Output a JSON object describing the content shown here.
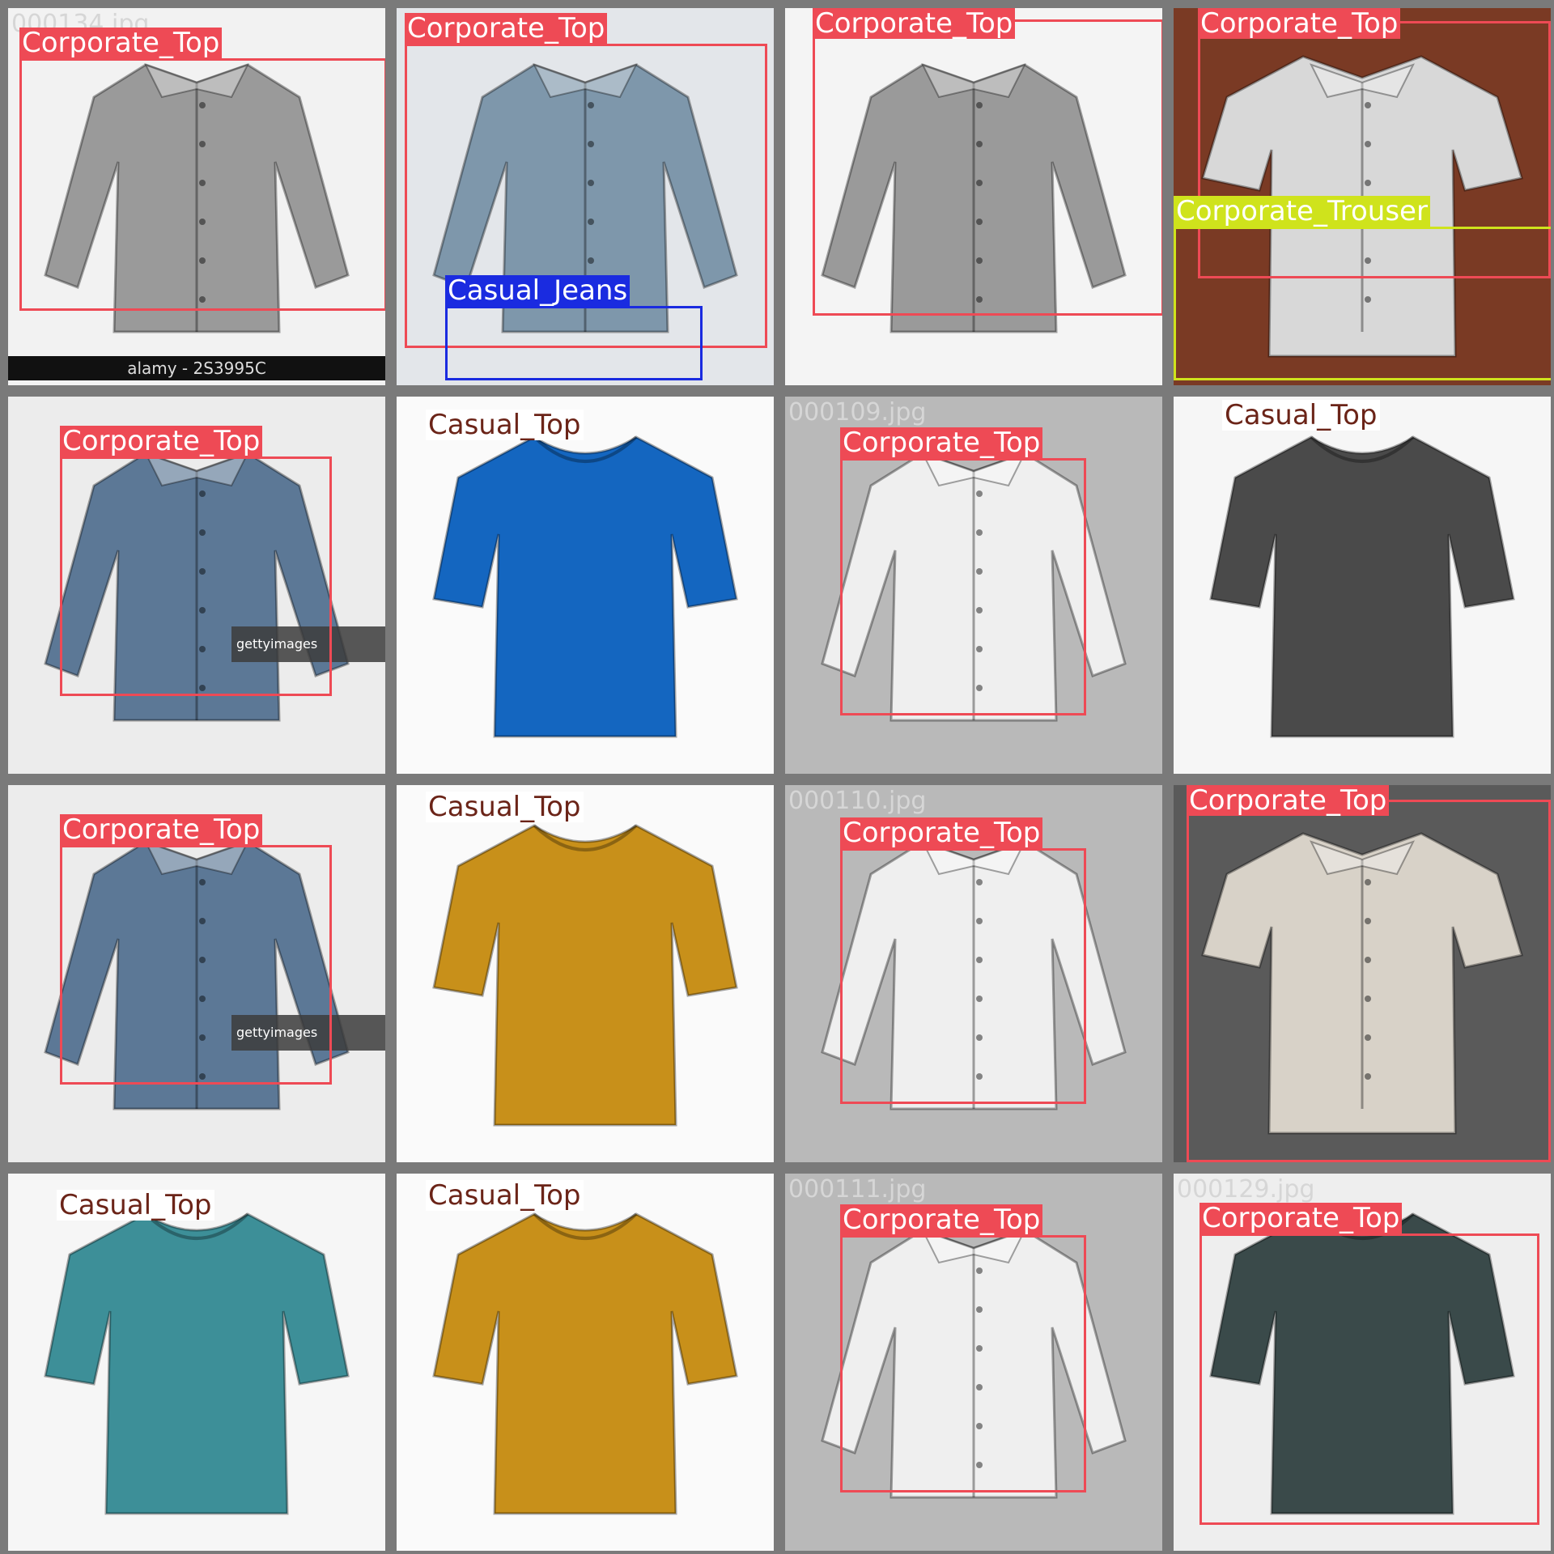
{
  "classes": {
    "Corporate_Top": {
      "box": "#ee4a55",
      "label_bg": "#ee4a55",
      "label_fg": "#ffffff"
    },
    "Casual_Jeans": {
      "box": "#1a2be0",
      "label_bg": "#1a2be0",
      "label_fg": "#ffffff"
    },
    "Corporate_Trouser": {
      "box": "#cfe31c",
      "label_bg": "#cfe31c",
      "label_fg": "#ffffff"
    },
    "Casual_Top": {
      "box": "#ffffff",
      "label_bg": "#ffffff",
      "label_fg": "#6b2418"
    }
  },
  "tiles": [
    {
      "filename": "000134.jpg",
      "bg": "#f2f2f2",
      "garment": "shirt-long",
      "color": "#9a9a9a",
      "watermark": "alamy - 2S3995C",
      "detections": [
        {
          "label": "Corporate_Top"
        }
      ]
    },
    {
      "filename": "",
      "bg": "#e3e6ea",
      "garment": "shirt-long",
      "color": "#7e97ab",
      "detections": [
        {
          "label": "Corporate_Top"
        },
        {
          "label": "Casual_Jeans"
        }
      ]
    },
    {
      "filename": "",
      "bg": "#f4f4f4",
      "garment": "shirt-long",
      "color": "#9a9a9a",
      "detections": [
        {
          "label": "Corporate_Top"
        }
      ]
    },
    {
      "filename": "",
      "bg": "#7a3a24",
      "garment": "shirt-short",
      "color": "#d8d8d8",
      "detections": [
        {
          "label": "Corporate_Top"
        },
        {
          "label": "Corporate_Trouser"
        }
      ]
    },
    {
      "filename": "",
      "bg": "#ececec",
      "garment": "shirt-long",
      "color": "#5c7896",
      "watermark": "gettyimages",
      "detections": [
        {
          "label": "Corporate_Top"
        }
      ]
    },
    {
      "filename": "",
      "bg": "#fafafa",
      "garment": "tee",
      "color": "#1466c0",
      "detections": [
        {
          "label": "Casual_Top"
        }
      ]
    },
    {
      "filename": "000109.jpg",
      "bg": "#b9b9b9",
      "garment": "shirt-long",
      "color": "#efefef",
      "detections": [
        {
          "label": "Corporate_Top"
        }
      ]
    },
    {
      "filename": "",
      "bg": "#f6f6f6",
      "garment": "tee",
      "color": "#4a4a4a",
      "detections": [
        {
          "label": "Casual_Top"
        }
      ]
    },
    {
      "filename": "",
      "bg": "#ececec",
      "garment": "shirt-long",
      "color": "#5c7896",
      "watermark": "gettyimages",
      "detections": [
        {
          "label": "Corporate_Top"
        }
      ]
    },
    {
      "filename": "",
      "bg": "#fafafa",
      "garment": "tee",
      "color": "#c8901a",
      "detections": [
        {
          "label": "Casual_Top"
        }
      ]
    },
    {
      "filename": "000110.jpg",
      "bg": "#b9b9b9",
      "garment": "shirt-long",
      "color": "#efefef",
      "detections": [
        {
          "label": "Corporate_Top"
        }
      ]
    },
    {
      "filename": "",
      "bg": "#5a5a5a",
      "garment": "shirt-short",
      "color": "#d8d2c8",
      "detections": [
        {
          "label": "Corporate_Top"
        }
      ]
    },
    {
      "filename": "",
      "bg": "#f6f6f6",
      "garment": "tee",
      "color": "#3d8f98",
      "detections": [
        {
          "label": "Casual_Top"
        }
      ]
    },
    {
      "filename": "",
      "bg": "#fafafa",
      "garment": "tee",
      "color": "#c8901a",
      "detections": [
        {
          "label": "Casual_Top"
        }
      ]
    },
    {
      "filename": "000111.jpg",
      "bg": "#b9b9b9",
      "garment": "shirt-long",
      "color": "#efefef",
      "detections": [
        {
          "label": "Corporate_Top"
        }
      ]
    },
    {
      "filename": "000129.jpg",
      "bg": "#eeeeee",
      "garment": "tee",
      "color": "#3a4a4a",
      "detections": [
        {
          "label": "Corporate_Top"
        }
      ]
    }
  ]
}
